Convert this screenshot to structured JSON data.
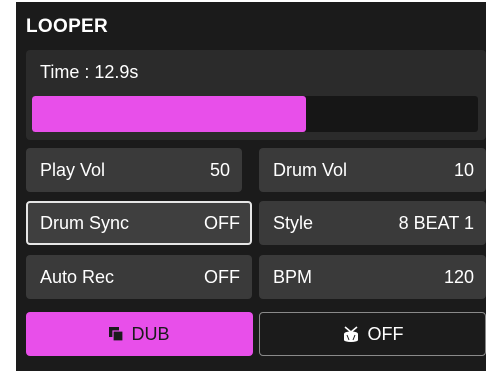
{
  "title": "LOOPER",
  "time": {
    "label": "Time : 12.9s",
    "progress": 0.615
  },
  "params": {
    "play_vol": {
      "label": "Play Vol",
      "value": "50"
    },
    "drum_vol": {
      "label": "Drum Vol",
      "value": "10"
    },
    "drum_sync": {
      "label": "Drum Sync",
      "value": "OFF"
    },
    "style": {
      "label": "Style",
      "value": "8 BEAT 1"
    },
    "auto_rec": {
      "label": "Auto Rec",
      "value": "OFF"
    },
    "bpm": {
      "label": "BPM",
      "value": "120"
    }
  },
  "buttons": {
    "dub": {
      "label": "DUB",
      "icon": "overdub-icon"
    },
    "drum": {
      "label": "OFF",
      "icon": "drum-icon"
    }
  },
  "colors": {
    "accent": "#e84fea",
    "panel": "#1b1b1b",
    "cell": "#3a3a3a"
  }
}
